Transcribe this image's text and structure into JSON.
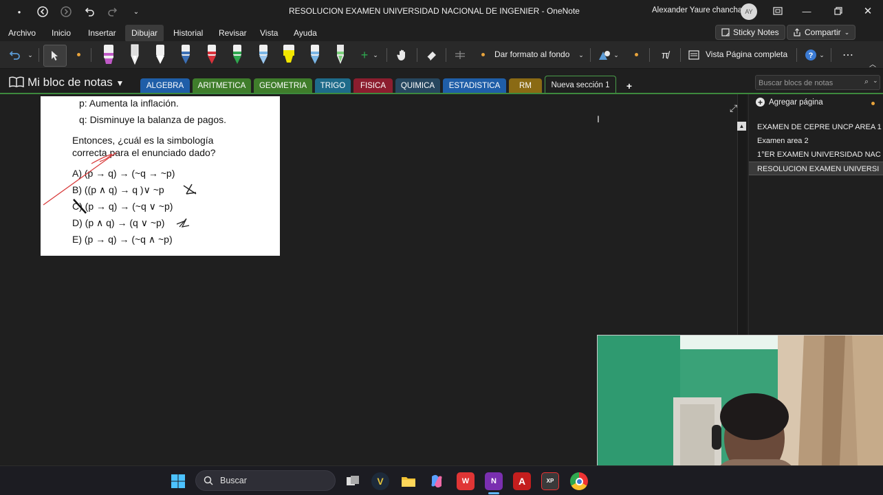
{
  "titlebar": {
    "title": "RESOLUCION EXAMEN UNIVERSIDAD NACIONAL DE INGENIER  -  OneNote",
    "user": "Alexander Yaure chancha",
    "avatar": "AY"
  },
  "menu": {
    "items": [
      "Archivo",
      "Inicio",
      "Insertar",
      "Dibujar",
      "Historial",
      "Revisar",
      "Vista",
      "Ayuda"
    ],
    "active": "Dibujar",
    "sticky_notes": "Sticky Notes",
    "share": "Compartir"
  },
  "ribbon": {
    "format_background": "Dar formato al fondo",
    "full_page_view": "Vista Página completa",
    "pen_colors": [
      "#c059c7",
      "#ffffff",
      "#ffffff",
      "#3b6fb5",
      "#d8323b",
      "#2fa84f",
      "#7ab6e6",
      "#f2e600",
      "#7ab6e6",
      "#7bd07b"
    ]
  },
  "notebook": {
    "title": "Mi bloc de notas",
    "search_placeholder": "Buscar blocs de notas",
    "sections": [
      {
        "label": "ALGEBRA",
        "color": "#1f5ea8"
      },
      {
        "label": "ARITMETICA",
        "color": "#3f7d2b"
      },
      {
        "label": "GEOMETRIA",
        "color": "#3f7d2b"
      },
      {
        "label": "TRIGO",
        "color": "#1e6b8a"
      },
      {
        "label": "FISICA",
        "color": "#8c1d2e"
      },
      {
        "label": "QUIMICA",
        "color": "#27475f"
      },
      {
        "label": "ESTADISTICA",
        "color": "#1f5ea8"
      },
      {
        "label": "RM",
        "color": "#8a6a14"
      }
    ],
    "current_section": "Nueva sección 1"
  },
  "page_content": {
    "lines": [
      "p:  Aumenta la inflación.",
      "q:  Disminuye la balanza de pagos.",
      "Entonces,   ¿cuál   es   la   simbología",
      "correcta para el enunciado dado?",
      "A)  (p → q) → (~q → ~p)",
      "B)  ((p ∧ q) → q )∨ ~p",
      "C)  (p → q) → (~q ∨ ~p)",
      "D)  (p ∧ q) → (q ∨ ~p)",
      "E)  (p → q) → (~q ∧ ~p)"
    ]
  },
  "pages_panel": {
    "add_page": "Agregar página",
    "pages": [
      "EXAMEN DE CEPRE UNCP AREA 1",
      "Examen area 2",
      "1°ER EXAMEN UNIVERSIDAD NAC",
      "RESOLUCION EXAMEN UNIVERSI"
    ],
    "selected_index": 3
  },
  "taskbar": {
    "search_label": "Buscar"
  }
}
